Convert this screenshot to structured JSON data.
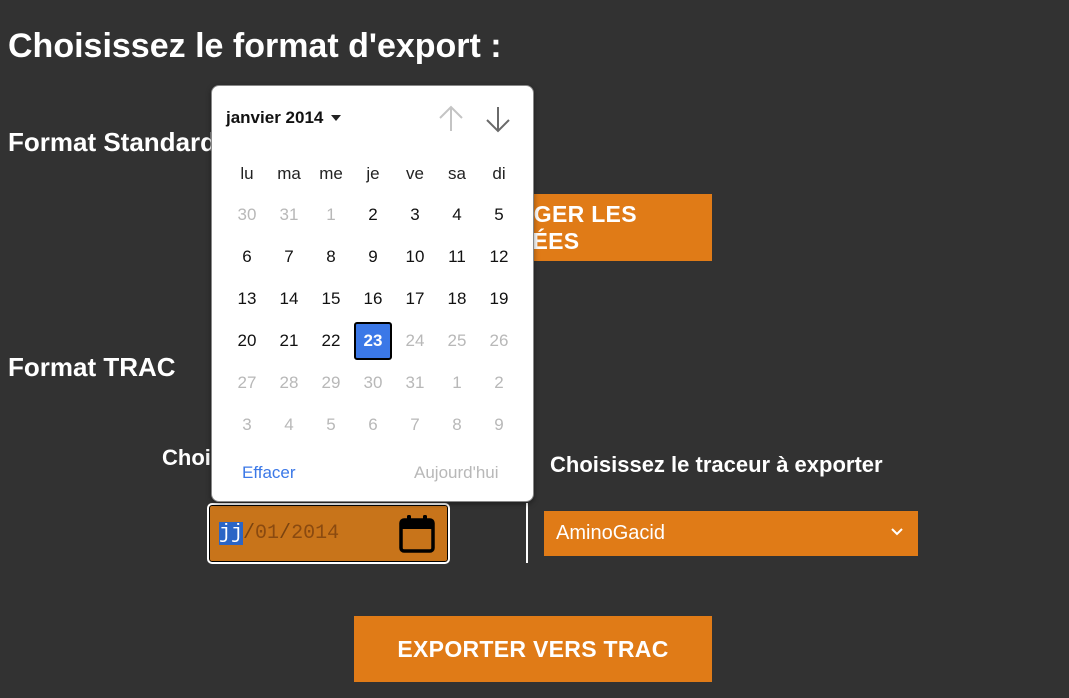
{
  "page_title": "Choisissez le format d'export :",
  "standard": {
    "title": "Format Standard",
    "button_label": "TÉLÉCHARGER LES DONNÉES"
  },
  "trac": {
    "title": "Format TRAC",
    "date_label": "Choisissez la date",
    "date_input": {
      "day": "jj",
      "month": "01",
      "year": "2014",
      "sep": "/"
    },
    "tracer_label": "Choisissez le traceur à exporter",
    "tracer_selected": "AminoGacid",
    "export_button": "EXPORTER VERS TRAC"
  },
  "calendar": {
    "month_label": "janvier 2014",
    "weekdays": [
      "lu",
      "ma",
      "me",
      "je",
      "ve",
      "sa",
      "di"
    ],
    "days": [
      {
        "d": "30",
        "muted": true
      },
      {
        "d": "31",
        "muted": true
      },
      {
        "d": "1",
        "muted": true
      },
      {
        "d": "2"
      },
      {
        "d": "3"
      },
      {
        "d": "4"
      },
      {
        "d": "5"
      },
      {
        "d": "6"
      },
      {
        "d": "7"
      },
      {
        "d": "8"
      },
      {
        "d": "9"
      },
      {
        "d": "10"
      },
      {
        "d": "11"
      },
      {
        "d": "12"
      },
      {
        "d": "13"
      },
      {
        "d": "14"
      },
      {
        "d": "15"
      },
      {
        "d": "16"
      },
      {
        "d": "17"
      },
      {
        "d": "18"
      },
      {
        "d": "19"
      },
      {
        "d": "20"
      },
      {
        "d": "21"
      },
      {
        "d": "22"
      },
      {
        "d": "23",
        "selected": true
      },
      {
        "d": "24",
        "muted": true
      },
      {
        "d": "25",
        "muted": true
      },
      {
        "d": "26",
        "muted": true
      },
      {
        "d": "27",
        "muted": true
      },
      {
        "d": "28",
        "muted": true
      },
      {
        "d": "29",
        "muted": true
      },
      {
        "d": "30",
        "muted": true
      },
      {
        "d": "31",
        "muted": true
      },
      {
        "d": "1",
        "muted": true
      },
      {
        "d": "2",
        "muted": true
      },
      {
        "d": "3",
        "muted": true
      },
      {
        "d": "4",
        "muted": true
      },
      {
        "d": "5",
        "muted": true
      },
      {
        "d": "6",
        "muted": true
      },
      {
        "d": "7",
        "muted": true
      },
      {
        "d": "8",
        "muted": true
      },
      {
        "d": "9",
        "muted": true
      }
    ],
    "clear_label": "Effacer",
    "today_label": "Aujourd'hui"
  },
  "colors": {
    "background": "#323232",
    "accent": "#e07b17",
    "selected_day": "#3b78e7"
  },
  "icons": {
    "calendar": "calendar-icon",
    "select": "chevron-down-icon",
    "prev": "arrow-up-icon",
    "next": "arrow-down-icon"
  }
}
